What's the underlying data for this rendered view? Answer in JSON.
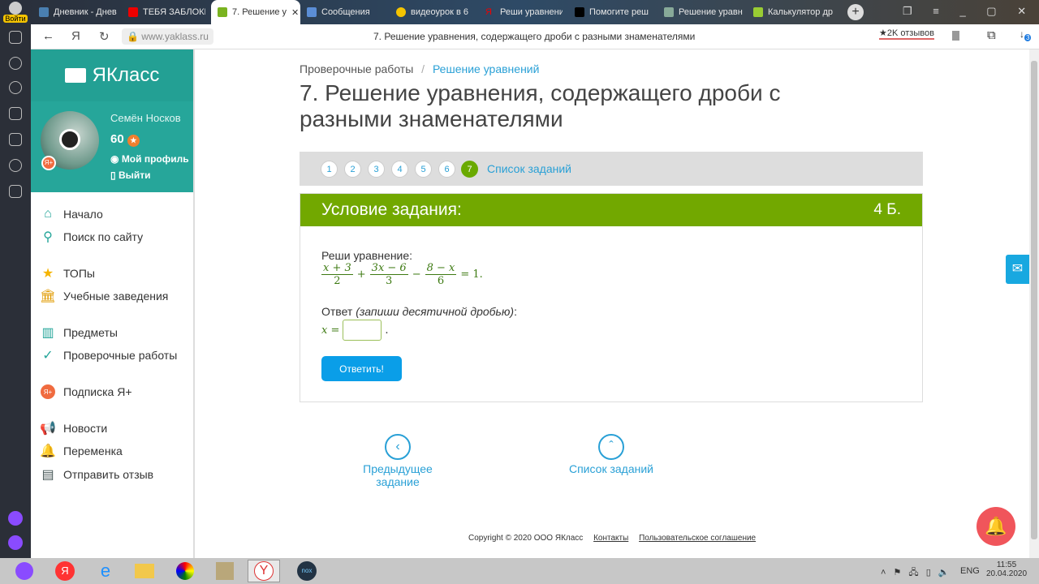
{
  "browser": {
    "login_label": "Войти",
    "tabs": [
      {
        "label": "Дневник - Днев"
      },
      {
        "label": "ТЕБЯ ЗАБЛОКИ"
      },
      {
        "label": "7. Решение у"
      },
      {
        "label": "Сообщения"
      },
      {
        "label": "видеоурок в 6"
      },
      {
        "label": "Реши уравнени"
      },
      {
        "label": "Помогите реш"
      },
      {
        "label": "Решение уравн"
      },
      {
        "label": "Калькулятор др"
      }
    ],
    "url": "www.yaklass.ru",
    "page_title": "7. Решение уравнения, содержащего дроби с разными знаменателями",
    "reviews": "★2K отзывов",
    "downloads_badge": "3"
  },
  "sidebar": {
    "logo": "ЯКласс",
    "user_name": "Семён Носков",
    "points": "60",
    "profile_link": "Мой профиль",
    "logout_link": "Выйти",
    "items": [
      {
        "label": "Начало"
      },
      {
        "label": "Поиск по сайту"
      },
      {
        "label": "ТОПы"
      },
      {
        "label": "Учебные заведения"
      },
      {
        "label": "Предметы"
      },
      {
        "label": "Проверочные работы"
      },
      {
        "label": "Подписка Я+"
      },
      {
        "label": "Новости"
      },
      {
        "label": "Переменка"
      },
      {
        "label": "Отправить отзыв"
      }
    ]
  },
  "main": {
    "breadcrumb": [
      "Проверочные работы",
      "/",
      "Решение уравнений"
    ],
    "title": "7. Решение уравнения, содержащего дроби с разными знаменателями",
    "pages": [
      "1",
      "2",
      "3",
      "4",
      "5",
      "6",
      "7"
    ],
    "task_list_link": "Список заданий",
    "condition_header": "Условие задания:",
    "score": "4 Б.",
    "prompt": "Реши уравнение:",
    "equation": {
      "f1n": "x + 3",
      "f1d": "2",
      "op1": "+",
      "f2n": "3x − 6",
      "f2d": "3",
      "op2": "−",
      "f3n": "8 − x",
      "f3d": "6",
      "rhs": "= 1."
    },
    "answer_label": "Ответ",
    "answer_hint": "(запиши десятичной дробью)",
    "answer_colon": ":",
    "answer_var": "x =",
    "answer_value": "",
    "answer_dot": ".",
    "submit": "Ответить!",
    "prev_task": "Предыдущее задание",
    "task_list": "Список заданий"
  },
  "footer": {
    "copyright": "Copyright © 2020 ООО ЯКласс",
    "contacts": "Контакты",
    "agreement": "Пользовательское соглашение"
  },
  "taskbar": {
    "lang": "ENG",
    "time": "11:55",
    "date": "20.04.2020"
  }
}
